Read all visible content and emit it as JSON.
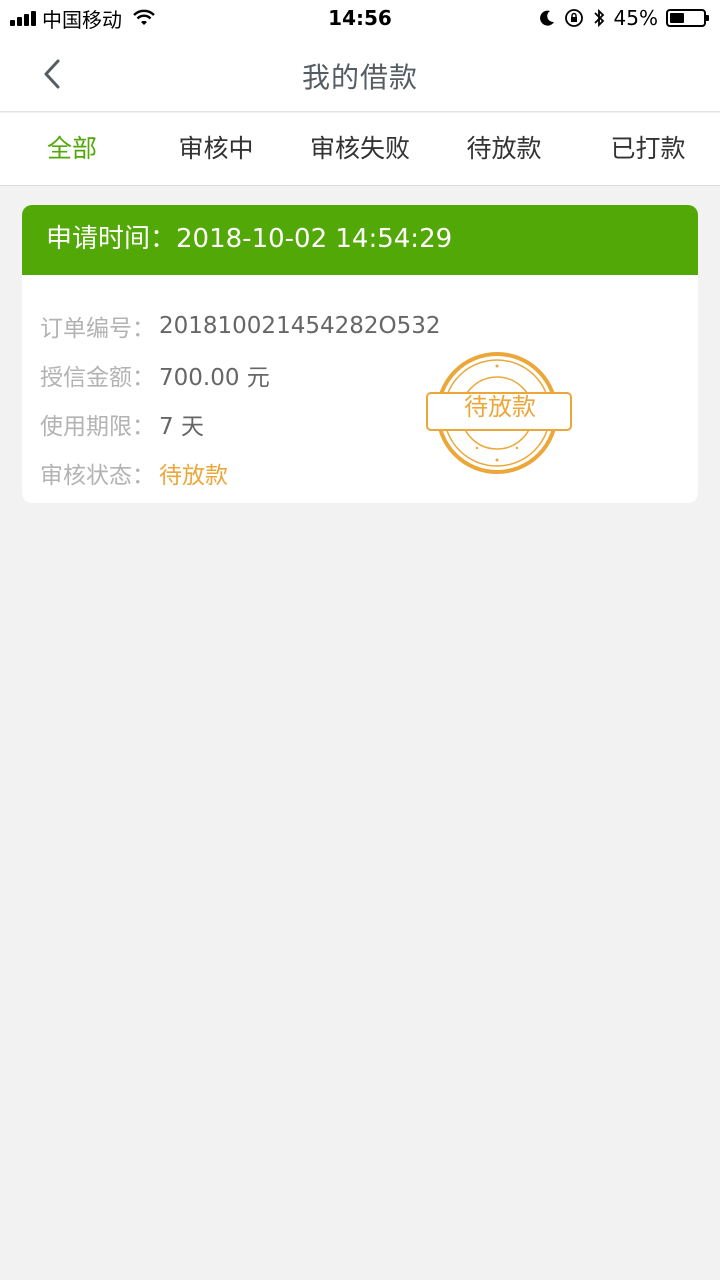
{
  "status_bar": {
    "carrier": "中国移动",
    "time": "14:56",
    "battery_percent_text": "45%",
    "battery_level": 0.45
  },
  "nav": {
    "title": "我的借款"
  },
  "tabs": [
    {
      "label": "全部",
      "active": true
    },
    {
      "label": "审核中",
      "active": false
    },
    {
      "label": "审核失败",
      "active": false
    },
    {
      "label": "待放款",
      "active": false
    },
    {
      "label": "已打款",
      "active": false
    }
  ],
  "order": {
    "apply_time_label": "申请时间：",
    "apply_time": "2018-10-02 14:54:29",
    "rows": [
      {
        "label": "订单编号：",
        "value": "201810021454282O532"
      },
      {
        "label": "授信金额：",
        "value": "700.00 元"
      },
      {
        "label": "使用期限：",
        "value": "7 天"
      },
      {
        "label": "审核状态：",
        "value": "待放款"
      }
    ],
    "stamp_text": "待放款"
  },
  "colors": {
    "accent_green": "#52a806",
    "status_orange": "#eba73a"
  }
}
